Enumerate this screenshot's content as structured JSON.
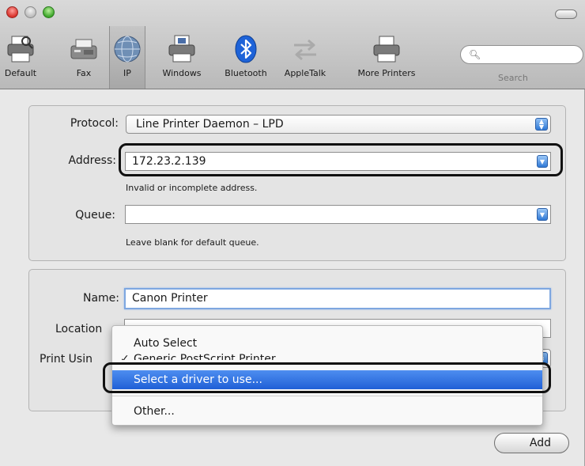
{
  "toolbar": {
    "items": [
      {
        "label": "Default",
        "icon": "printer-default-icon"
      },
      {
        "label": "Fax",
        "icon": "fax-icon"
      },
      {
        "label": "IP",
        "icon": "globe-icon"
      },
      {
        "label": "Windows",
        "icon": "windows-printer-icon"
      },
      {
        "label": "Bluetooth",
        "icon": "bluetooth-icon"
      },
      {
        "label": "AppleTalk",
        "icon": "appletalk-icon"
      },
      {
        "label": "More Printers",
        "icon": "printer-icon"
      }
    ],
    "search_label": "Search",
    "search_value": ""
  },
  "ip_group": {
    "protocol_label": "Protocol:",
    "protocol_value": "Line Printer Daemon – LPD",
    "address_label": "Address:",
    "address_value": "172.23.2.139",
    "address_hint": "Invalid or incomplete address.",
    "queue_label": "Queue:",
    "queue_value": "",
    "queue_hint": "Leave blank for default queue."
  },
  "printer_group": {
    "name_label": "Name:",
    "name_value": "Canon Printer",
    "location_label": "Location",
    "print_using_label": "Print Usin"
  },
  "driver_menu": {
    "items": [
      {
        "label": "Auto Select"
      },
      {
        "label": "Generic PostScript Printer",
        "checked": true
      },
      {
        "label": "Select a driver to use...",
        "highlighted": true
      },
      {
        "label": "Other..."
      }
    ],
    "check_glyph": "✓"
  },
  "add_button": "Add",
  "colors": {
    "accent": "#2f79d6",
    "menu_highlight": "#1f5fd6",
    "window_bg": "#e8e8e8"
  }
}
